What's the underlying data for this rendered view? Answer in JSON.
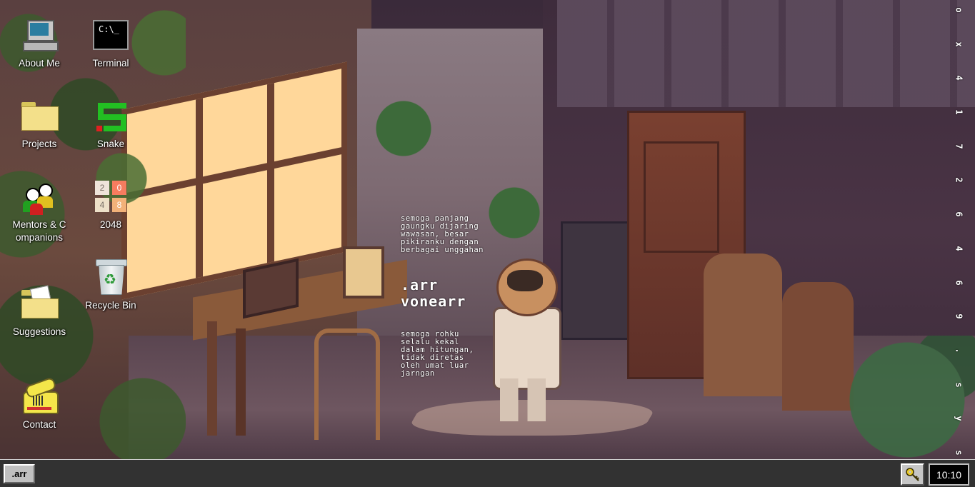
{
  "desktop": {
    "icons": [
      {
        "label": "About Me",
        "icon": "computer-icon"
      },
      {
        "label": "Terminal",
        "icon": "terminal-icon",
        "glyph_text": "C:\\_"
      },
      {
        "label": "Projects",
        "icon": "folder-icon"
      },
      {
        "label": "Snake",
        "icon": "snake-icon"
      },
      {
        "label": "Mentors & Companions",
        "icon": "people-icon"
      },
      {
        "label": "2048",
        "icon": "2048-icon",
        "tiles": [
          "2",
          "0",
          "4",
          "8"
        ]
      },
      {
        "label": "Suggestions",
        "icon": "folder-with-paper-icon"
      },
      {
        "label": "Recycle Bin",
        "icon": "recycle-bin-icon"
      },
      {
        "label": "Contact",
        "icon": "telephone-icon"
      }
    ]
  },
  "poem": {
    "top": "semoga panjang\ngaungku dijaring\nwawasan, besar\npikiranku dengan\nberbagai unggahan",
    "name": ".arr\nvonearr",
    "bottom": "semoga rohku\nselalu kekal\ndalam hitungan,\ntidak diretas\noleh umat luar\njarngan"
  },
  "side_strip": [
    "o",
    "x",
    "4",
    "1",
    "7",
    "2",
    "6",
    "4",
    "6",
    "9",
    ".",
    "s",
    "y",
    "s"
  ],
  "taskbar": {
    "start_label": ".arr",
    "tray_icon": "key-icon",
    "clock": "10:10"
  },
  "colors": {
    "taskbar_bg": "#323232",
    "button_face": "#c0c0c0",
    "clock_bg": "#000000"
  }
}
